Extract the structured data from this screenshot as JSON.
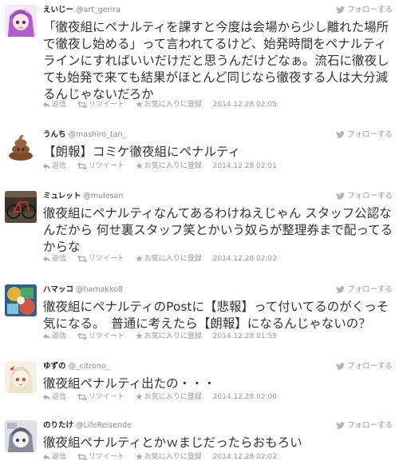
{
  "colors": {
    "bird": "#b4b4b4",
    "icon": "#aaaaaa",
    "text": "#333333",
    "meta": "#999999"
  },
  "tweets": [
    {
      "name": "えいじー",
      "handle": "@art_gerira",
      "follow": "フォローする",
      "lines": [
        "「徹夜組にペナルティを課すと今度は会場から少し離れた場所",
        "で徹夜し始める」って言われてるけど、始発時間をペナルティ",
        "ラインにすればいいだけだと思うんだけどなぁ。流石に徹夜し",
        "ても始発で来ても結果がほとんど同じなら徹夜する人は大分減",
        "るんじゃないだろか"
      ],
      "reply": "返信",
      "retweet": "リツイート",
      "favorite": "お気に入りに登録",
      "timestamp": "2014.12.28 02:05",
      "avatar_icon": "anime-girl-avatar"
    },
    {
      "name": "うんち",
      "handle": "@mashiro_tan_",
      "follow": "フォローする",
      "lines": [
        "【朗報】コミケ徹夜組にペナルティ"
      ],
      "reply": "返信",
      "retweet": "リツイート",
      "favorite": "お気に入りに登録",
      "timestamp": "2014.12.28 02:01",
      "avatar_icon": "poop-avatar"
    },
    {
      "name": "ミュレット",
      "handle": "@mulesan",
      "follow": "フォローする",
      "lines": [
        "徹夜組にペナルティなんてあるわけねえじゃん スタッフ公認な",
        "んだから 何せ裏スタッフ笑とかいう奴らが整理券まで配ってる",
        "からな"
      ],
      "reply": "返信",
      "retweet": "リツイート",
      "favorite": "お気に入りに登録",
      "timestamp": "2014.12.28 02:02",
      "avatar_icon": "bicycle-photo-avatar"
    },
    {
      "name": "ハマッコ",
      "handle": "@hamakko8",
      "follow": "フォローする",
      "lines": [
        "徹夜組にペナルティのPostに【悲報】って付いてるのがくっそ",
        "気になる。　普通に考えたら【朗報】になるんじゃないの？"
      ],
      "reply": "返信",
      "retweet": "リツイート",
      "favorite": "お気に入りに登録",
      "timestamp": "2014.12.28 01:59",
      "avatar_icon": "colorful-illustration-avatar"
    },
    {
      "name": "ゆずの",
      "handle": "@_citrono_",
      "follow": "フォローする",
      "lines": [
        "徹夜組ペナルティ出たの・・・"
      ],
      "reply": "返信",
      "retweet": "リツイート",
      "favorite": "お気に入りに登録",
      "timestamp": "2014.12.28 02:00",
      "avatar_icon": "anime-character-avatar"
    },
    {
      "name": "のりたけ",
      "handle": "@LifeReisende",
      "follow": "フォローする",
      "lines": [
        "徹夜組ペナルティとかｗまじだったらおもろい"
      ],
      "reply": "返信",
      "retweet": "リツイート",
      "favorite": "お気に入りに登録",
      "timestamp": "2014.12.28 02:02",
      "avatar_icon": "sketch-character-avatar"
    }
  ]
}
